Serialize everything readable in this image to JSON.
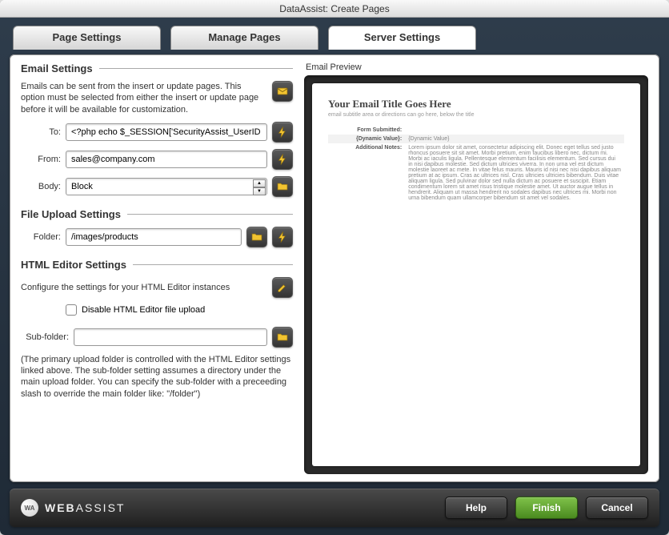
{
  "window": {
    "title": "DataAssist: Create Pages"
  },
  "tabs": [
    {
      "label": "Page Settings"
    },
    {
      "label": "Manage Pages"
    },
    {
      "label": "Server Settings"
    }
  ],
  "email": {
    "section_title": "Email Settings",
    "desc": "Emails can be sent from the insert or update pages. This option must be selected from either the insert or update page before it will be available for customization.",
    "to_label": "To:",
    "to_value": "<?php echo $_SESSION['SecurityAssist_UserID",
    "from_label": "From:",
    "from_value": "sales@company.com",
    "body_label": "Body:",
    "body_value": "Block"
  },
  "upload": {
    "section_title": "File Upload Settings",
    "folder_label": "Folder:",
    "folder_value": "/images/products"
  },
  "editor": {
    "section_title": "HTML Editor Settings",
    "desc": "Configure the settings for your HTML Editor instances",
    "disable_label": "Disable HTML Editor file upload",
    "subfolder_label": "Sub-folder:",
    "subfolder_value": "",
    "note": "(The primary upload folder is controlled with the HTML Editor settings linked above. The sub-folder setting assumes a directory under the main upload folder. You can specify the sub-folder with a preceeding slash to override the main folder like: \"/folder\")"
  },
  "preview": {
    "label": "Email Preview",
    "title": "Your Email Title Goes Here",
    "subtitle": "email subtitle area or directions can go here, below the title",
    "rows": [
      {
        "k": "Form Submitted:",
        "v": ""
      },
      {
        "k": "{Dynamic Value}:",
        "v": "{Dynamic Value}"
      },
      {
        "k": "Additional Notes:",
        "v": "Lorem ipsum dolor sit amet, consectetur adipiscing elit. Donec eget tellus sed justo rhoncus posuere sit sit amet. Morbi pretium, enim faucibus libero nec, dictum mi. Morbi ac iaculis ligula. Pellentesque elementum facilisis elementum. Sed cursus dui in nisi dapibus molestie. Sed dictum ultricies viverra. In non urna vel est dictum molestie laoreet ac mete. In vitae felus mauris. Mauris id nisi nec nisi dapibus aliquam pretium at ac ipsum. Cras ac ultrices nisl. Cras ultricies ultricies bibendum. Duis vitae aliquam ligula. Sed pulvinar dolor sed nulla dictum ac posuere et suscipit. Etiam condimentum lorem sit amet risus tristique molestie amet. Ut auctor augue tellus in hendrerit. Aliquam ut massa hendrerit no sodales dapibus nec ultrices mi. Morbi non urna bibendum quam ullamcorper bibendum sit amet vel sodales."
      }
    ]
  },
  "footer": {
    "brand1": "WEB",
    "brand2": "ASSIST",
    "help": "Help",
    "finish": "Finish",
    "cancel": "Cancel"
  }
}
